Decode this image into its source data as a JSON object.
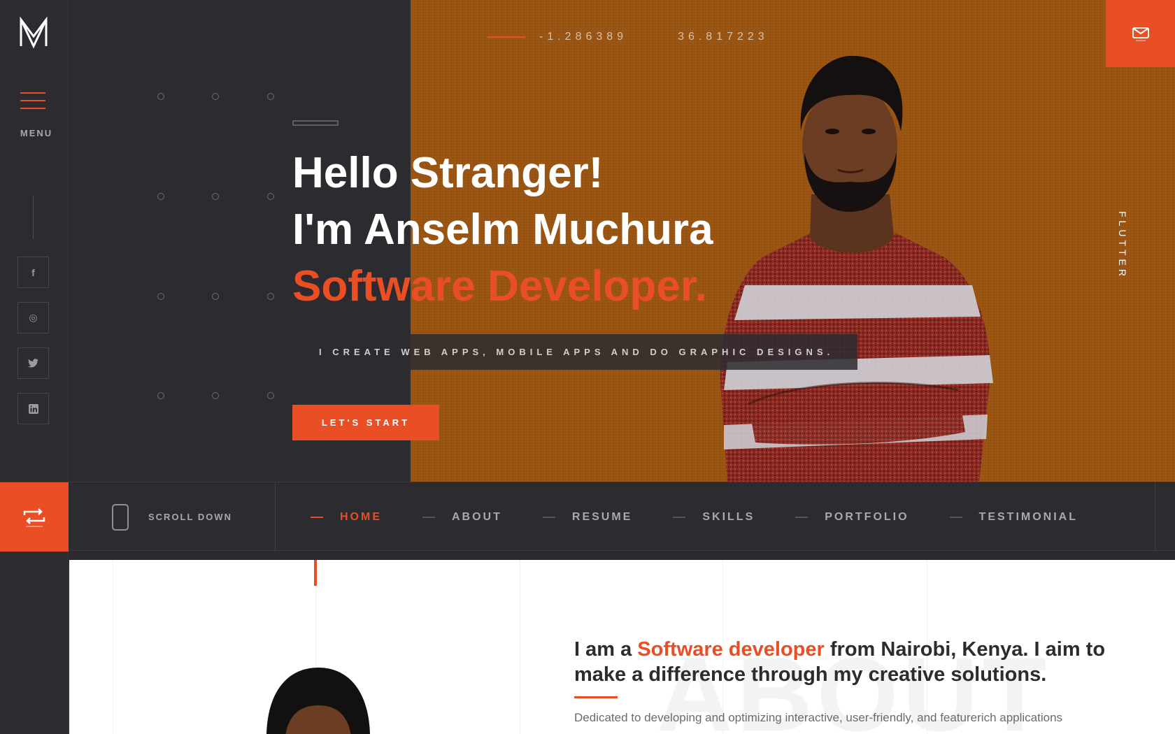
{
  "brand": {
    "logo_icon": "monogram-logo-icon"
  },
  "sidebar": {
    "menu_label": "MENU",
    "social": [
      {
        "name": "facebook",
        "glyph": "f"
      },
      {
        "name": "instagram",
        "glyph": "◎"
      },
      {
        "name": "twitter",
        "glyph": "🐦"
      },
      {
        "name": "linkedin",
        "glyph": "in"
      }
    ]
  },
  "hero": {
    "coords": {
      "lat": "-1.286389",
      "lng": "36.817223"
    },
    "line1": "Hello Stranger!",
    "line2": "I'm Anselm Muchura",
    "line3": "Software Developer.",
    "tagline": "I CREATE WEB APPS, MOBILE APPS AND DO GRAPHIC DESIGNS.",
    "cta": "LET'S START",
    "vertical_text": "FLUTTER",
    "mail_icon": "mail-icon"
  },
  "nav": {
    "scroll_label": "SCROLL DOWN",
    "items": [
      "HOME",
      "ABOUT",
      "RESUME",
      "SKILLS",
      "PORTFOLIO",
      "TESTIMONIAL"
    ],
    "active": "HOME"
  },
  "about": {
    "watermark": "ABOUT",
    "head_pre": "I am a ",
    "head_hl": "Software developer",
    "head_post": " from Nairobi, Kenya. I aim to make a difference through my creative solutions.",
    "text": "Dedicated to developing and optimizing interactive, user-friendly, and featurerich applications"
  },
  "colors": {
    "accent": "#e94e24",
    "dark": "#2b2b30",
    "orange_bg": "#9b5614"
  }
}
